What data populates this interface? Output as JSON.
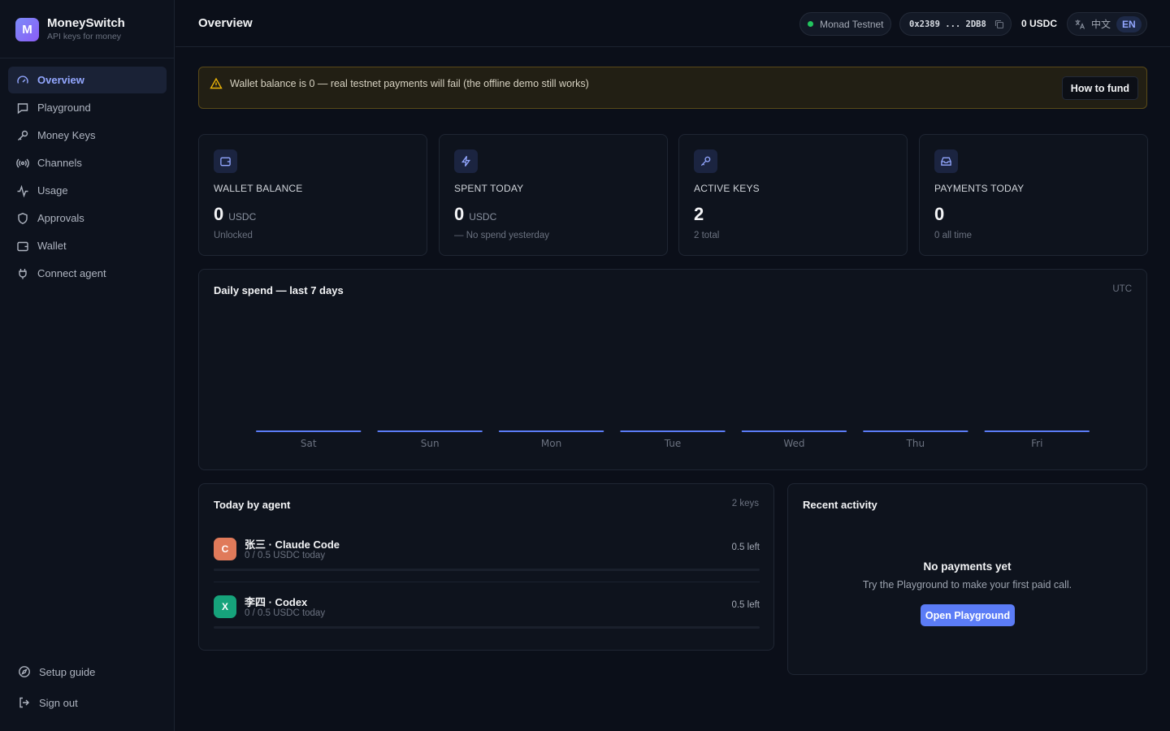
{
  "brand": {
    "logo_letter": "M",
    "name": "MoneySwitch",
    "tagline": "API keys for money"
  },
  "sidebar": {
    "items": [
      {
        "label": "Overview",
        "icon": "gauge-icon",
        "active": true
      },
      {
        "label": "Playground",
        "icon": "chat-icon"
      },
      {
        "label": "Money Keys",
        "icon": "key-icon"
      },
      {
        "label": "Channels",
        "icon": "broadcast-icon"
      },
      {
        "label": "Usage",
        "icon": "activity-icon"
      },
      {
        "label": "Approvals",
        "icon": "shield-icon"
      },
      {
        "label": "Wallet",
        "icon": "wallet-icon"
      },
      {
        "label": "Connect agent",
        "icon": "plug-icon"
      }
    ],
    "bottom": [
      {
        "label": "Setup guide",
        "icon": "compass-icon"
      },
      {
        "label": "Sign out",
        "icon": "logout-icon"
      }
    ]
  },
  "header": {
    "title": "Overview",
    "network": "Monad Testnet",
    "address": "0x2389 ... 2DB8",
    "balance": "0 USDC",
    "lang_zh": "中文",
    "lang_en": "EN"
  },
  "alert": {
    "text": "Wallet balance is 0 — real testnet payments will fail (the offline demo still works)",
    "button": "How to fund"
  },
  "stats": [
    {
      "label": "WALLET BALANCE",
      "value": "0",
      "unit": "USDC",
      "sub": "Unlocked",
      "icon": "wallet-icon"
    },
    {
      "label": "SPENT TODAY",
      "value": "0",
      "unit": "USDC",
      "sub": "— No spend yesterday",
      "icon": "bolt-icon"
    },
    {
      "label": "ACTIVE KEYS",
      "value": "2",
      "unit": "",
      "sub": "2 total",
      "icon": "key-icon"
    },
    {
      "label": "PAYMENTS TODAY",
      "value": "0",
      "unit": "",
      "sub": "0 all time",
      "icon": "inbox-icon"
    }
  ],
  "chart": {
    "title": "Daily spend — last 7 days",
    "timezone": "UTC"
  },
  "chart_data": {
    "type": "bar",
    "categories": [
      "Sat",
      "Sun",
      "Mon",
      "Tue",
      "Wed",
      "Thu",
      "Fri"
    ],
    "values": [
      0,
      0,
      0,
      0,
      0,
      0,
      0
    ],
    "title": "Daily spend — last 7 days",
    "xlabel": "",
    "ylabel": "",
    "grid": false
  },
  "agents": {
    "title": "Today by agent",
    "count": "2 keys",
    "rows": [
      {
        "initial": "C",
        "color": "#e07a5a",
        "name": "张三 · Claude Code",
        "usage": "0 / 0.5 USDC today",
        "left": "0.5 left",
        "fraction": 0
      },
      {
        "initial": "X",
        "color": "#16a37b",
        "name": "李四 · Codex",
        "usage": "0 / 0.5 USDC today",
        "left": "0.5 left",
        "fraction": 0
      }
    ]
  },
  "activity": {
    "title": "Recent activity",
    "empty_title": "No payments yet",
    "empty_sub": "Try the Playground to make your first paid call.",
    "button": "Open Playground"
  },
  "colors": {
    "accent": "#5b7cf6",
    "active_nav": "#93a7ff",
    "online": "#22c55e",
    "warning": "#eab308"
  }
}
